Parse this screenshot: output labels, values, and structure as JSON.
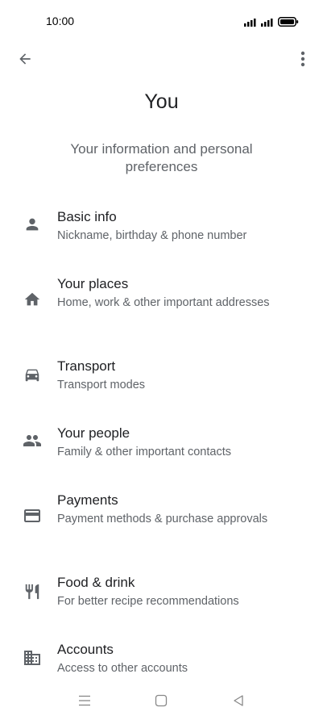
{
  "status_bar": {
    "time": "10:00"
  },
  "header": {
    "title": "You",
    "subtitle": "Your information and personal preferences"
  },
  "menu": {
    "items": [
      {
        "icon": "person-icon",
        "title": "Basic info",
        "description": "Nickname, birthday & phone number"
      },
      {
        "icon": "home-icon",
        "title": "Your places",
        "description": "Home, work & other important addresses"
      },
      {
        "icon": "car-icon",
        "title": "Transport",
        "description": "Transport modes"
      },
      {
        "icon": "people-icon",
        "title": "Your people",
        "description": "Family & other important contacts"
      },
      {
        "icon": "credit-card-icon",
        "title": "Payments",
        "description": "Payment methods & purchase approvals"
      },
      {
        "icon": "restaurant-icon",
        "title": "Food & drink",
        "description": "For better recipe recommendations"
      },
      {
        "icon": "business-icon",
        "title": "Accounts",
        "description": "Access to other accounts"
      }
    ]
  },
  "colors": {
    "primary_text": "#202124",
    "secondary_text": "#5f6368",
    "icon": "#5f6368",
    "background": "#ffffff"
  }
}
